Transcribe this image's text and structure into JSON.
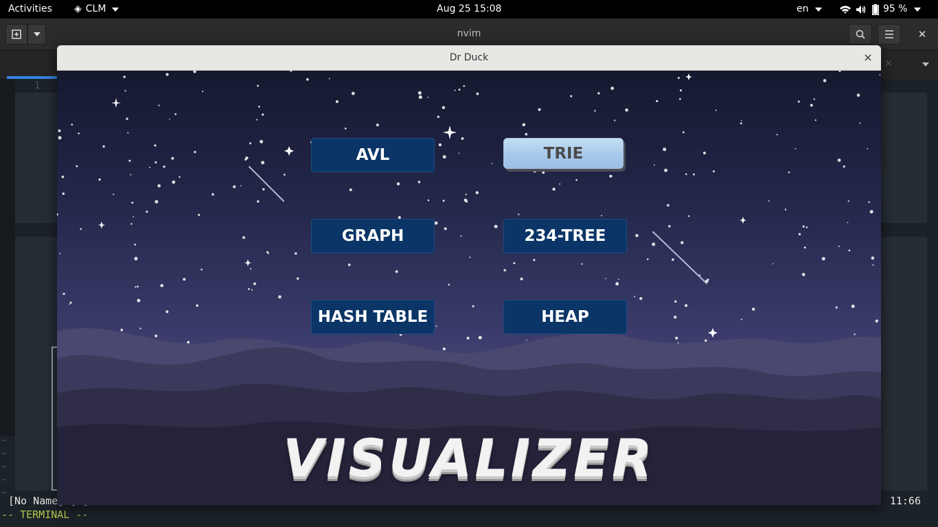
{
  "topbar": {
    "activities": "Activities",
    "app_menu": "CLM",
    "clock": "Aug 25  15:08",
    "language": "en",
    "battery": "95 %"
  },
  "terminal": {
    "title": "nvim",
    "line_number": "1",
    "statusline": "[No Name] [-]",
    "cursor_pos": "11:66",
    "mode": "-- TERMINAL --",
    "tildes": [
      "~",
      "~",
      "~",
      "~",
      "~"
    ]
  },
  "dialog": {
    "title": "Dr Duck",
    "close": "×"
  },
  "menu": {
    "avl": "AVL",
    "trie": "TRIE",
    "graph": "GRAPH",
    "tree234": "234-TREE",
    "hash_table": "HASH TABLE",
    "heap": "HEAP"
  },
  "logo": "VISUALIZER",
  "colors": {
    "button_bg": "#0b3566",
    "button_hover_bg": "#a7c8ea",
    "sky_top": "#15192f",
    "sky_bottom": "#4b4a78"
  }
}
